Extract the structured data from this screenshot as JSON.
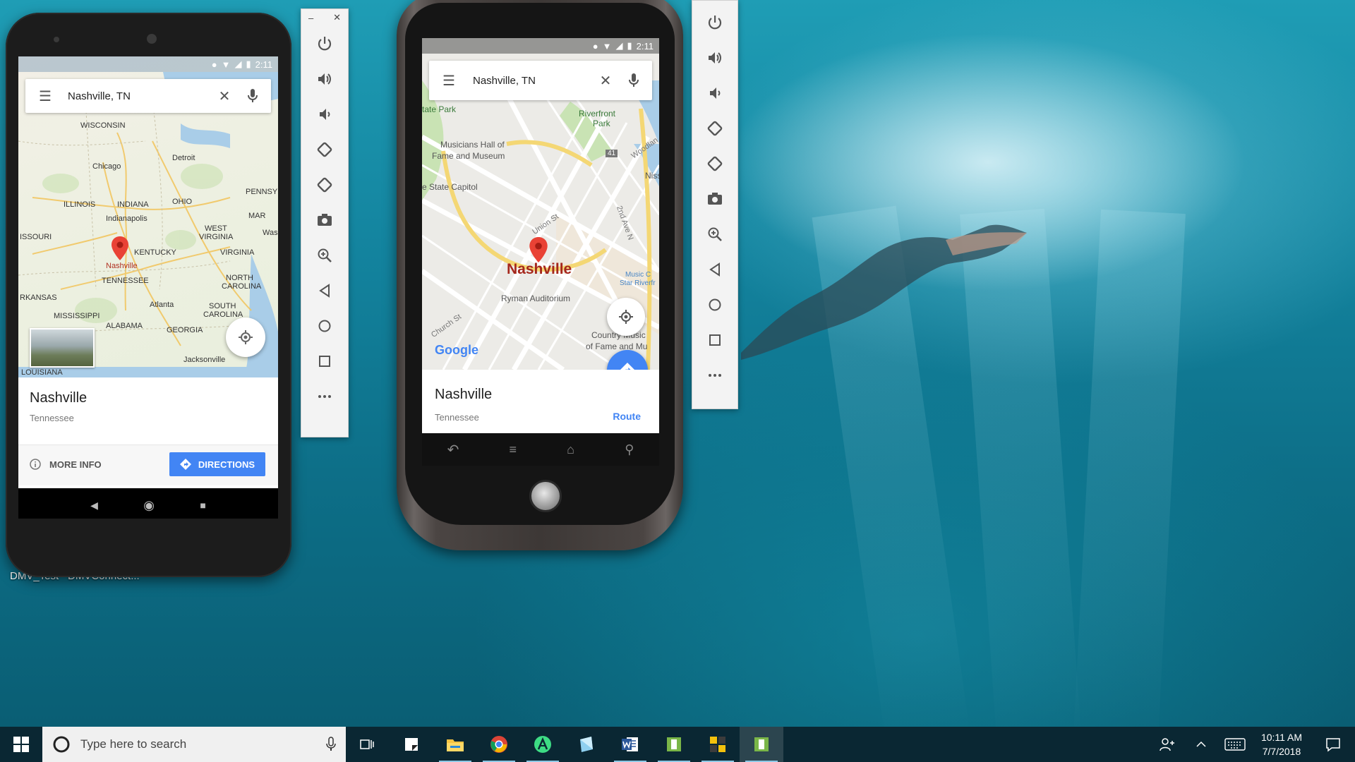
{
  "desktop": {
    "icons": [
      {
        "label": "DMV_Test"
      },
      {
        "label": "DMVConnect..."
      }
    ]
  },
  "phone1": {
    "status_time": "2:11",
    "search_value": "Nashville, TN",
    "map_labels": {
      "chicago": "Chicago",
      "detroit": "Detroit",
      "illinois": "ILLINOIS",
      "indiana": "INDIANA",
      "ohio": "OHIO",
      "indianapolis": "Indianapolis",
      "pennsylvania": "PENNSYL",
      "west_virginia_1": "WEST",
      "west_virginia_2": "VIRGINIA",
      "missouri": "ISSOURI",
      "kentucky": "KENTUCKY",
      "virginia": "VIRGINIA",
      "wash": "Wasl",
      "mar": "MAR",
      "nashville": "Nashville",
      "tennessee": "TENNESSEE",
      "north_carolina_1": "NORTH",
      "north_carolina_2": "CAROLINA",
      "arkansas": "RKANSAS",
      "mississippi": "MISSISSIPPI",
      "atlanta": "Atlanta",
      "south_carolina_1": "SOUTH",
      "south_carolina_2": "CAROLINA",
      "alabama": "ALABAMA",
      "georgia": "GEORGIA",
      "jacksonville": "Jacksonville",
      "louisiana": "LOUISIANA",
      "wisconsin": "WISCONSIN"
    },
    "place_title": "Nashville",
    "place_subtitle": "Tennessee",
    "more_info_label": "MORE INFO",
    "directions_label": "DIRECTIONS"
  },
  "phone2": {
    "status_time": "2:11",
    "search_value": "Nashville, TN",
    "map_labels": {
      "state_park": "tate Park",
      "riverfront": "Riverfront",
      "park": "Park",
      "musicians_1": "Musicians Hall of",
      "musicians_2": "Fame and Museum",
      "state_capitol": "e State Capitol",
      "nashville": "Nashville",
      "ryman": "Ryman Auditorium",
      "church_st": "Church St",
      "union_st": "Union St",
      "second_ave": "2nd Ave N",
      "country_1": "Country Music",
      "country_2": "of Fame and Mu",
      "music_1": "Music C",
      "music_2": "Star Riverfr",
      "niss": "Niss",
      "woodland": "Woodlan",
      "route41": "41",
      "google": "Google"
    },
    "place_title": "Nashville",
    "place_subtitle": "Tennessee",
    "route_label": "Route"
  },
  "taskbar": {
    "search_placeholder": "Type here to search",
    "time": "10:11 AM",
    "date": "7/7/2018"
  },
  "colors": {
    "accent_blue": "#4285f4",
    "pin_red": "#e94235",
    "taskbar": "#0a2733"
  }
}
